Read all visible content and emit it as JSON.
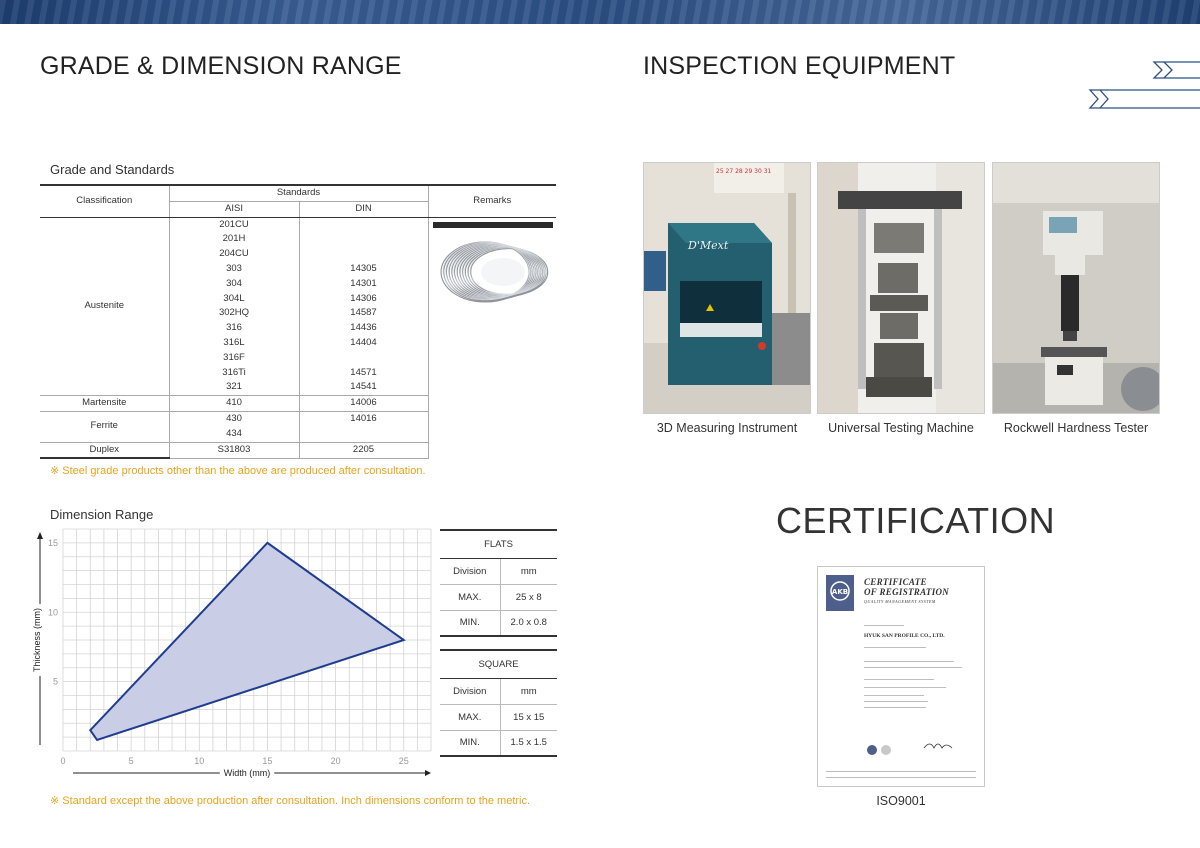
{
  "left": {
    "title": "GRADE & DIMENSION RANGE",
    "grade_subtitle": "Grade and Standards",
    "grade_table": {
      "headers": {
        "classification": "Classification",
        "standards": "Standards",
        "aisi": "AISI",
        "din": "DIN",
        "remarks": "Remarks"
      },
      "austenite_label": "Austenite",
      "austenite_rows": [
        [
          "201CU",
          ""
        ],
        [
          "201H",
          ""
        ],
        [
          "204CU",
          ""
        ],
        [
          "303",
          "14305"
        ],
        [
          "304",
          "14301"
        ],
        [
          "304L",
          "14306"
        ],
        [
          "302HQ",
          "14587"
        ],
        [
          "316",
          "14436"
        ],
        [
          "316L",
          "14404"
        ],
        [
          "316F",
          ""
        ],
        [
          "316Ti",
          "14571"
        ],
        [
          "321",
          "14541"
        ]
      ],
      "martensite_label": "Martensite",
      "martensite_row": [
        "410",
        "14006"
      ],
      "ferrite_label": "Ferrite",
      "ferrite_rows": [
        [
          "430",
          "14016"
        ],
        [
          "434",
          ""
        ]
      ],
      "duplex_label": "Duplex",
      "duplex_row": [
        "S31803",
        "2205"
      ]
    },
    "grade_note": "※ Steel grade products other than the above are produced after consultation.",
    "dimension_subtitle": "Dimension Range",
    "dimension_note": "※ Standard except the above production after consultation. Inch dimensions conform to the metric."
  },
  "chart_data": {
    "type": "area",
    "title": "",
    "xlabel": "Width (mm)",
    "ylabel": "Thickness (mm)",
    "xlim": [
      0,
      27
    ],
    "ylim": [
      0,
      16
    ],
    "xticks": [
      0,
      5,
      10,
      15,
      20,
      25
    ],
    "yticks": [
      5,
      10,
      15
    ],
    "grid": true,
    "polygon": [
      [
        15,
        15
      ],
      [
        25,
        8
      ],
      [
        2.5,
        0.8
      ],
      [
        2,
        1.5
      ]
    ],
    "fill_color": "#c9cde6",
    "stroke_color": "#1f3d8c"
  },
  "flats": {
    "title": "FLATS",
    "rows": [
      [
        "Division",
        "mm"
      ],
      [
        "MAX.",
        "25 x 8"
      ],
      [
        "MIN.",
        "2.0 x 0.8"
      ]
    ]
  },
  "square": {
    "title": "SQUARE",
    "rows": [
      [
        "Division",
        "mm"
      ],
      [
        "MAX.",
        "15 x 15"
      ],
      [
        "MIN.",
        "1.5 x 1.5"
      ]
    ]
  },
  "right": {
    "title": "INSPECTION EQUIPMENT",
    "equipment": [
      {
        "caption": "3D Measuring Instrument"
      },
      {
        "caption": "Universal Testing Machine"
      },
      {
        "caption": "Rockwell Hardness Tester"
      }
    ],
    "photo1_calendar": "25 27 28 29 30 31",
    "photo1_logo": "D'Mext",
    "cert_title": "CERTIFICATION",
    "cert_caption": "ISO9001",
    "certificate": {
      "line1": "CERTIFICATE",
      "line2": "OF REGISTRATION",
      "line3": "QUALITY MANAGEMENT SYSTEM",
      "company": "HYUK SAN PROFILE CO., LTD.",
      "badge": "AKB",
      "accent": "#4d5f8a"
    }
  },
  "colors": {
    "band": "#2c4f84",
    "note": "#e5a420",
    "polygon_stroke": "#1f3d8c"
  }
}
